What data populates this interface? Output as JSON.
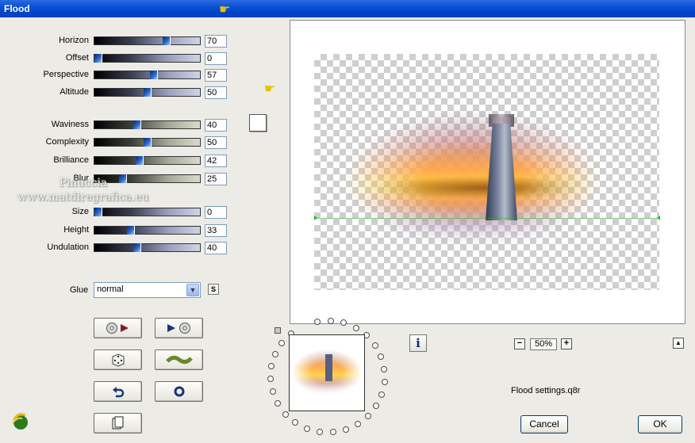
{
  "window": {
    "title": "Flood"
  },
  "sliders": [
    {
      "label": "Horizon",
      "value": "70",
      "level": 0.7,
      "style": "dark"
    },
    {
      "label": "Offset",
      "value": "0",
      "level": 0.0,
      "style": "dark"
    },
    {
      "label": "Perspective",
      "value": "57",
      "level": 0.57,
      "style": "dark"
    },
    {
      "label": "Altitude",
      "value": "50",
      "level": 0.5,
      "style": "dark"
    },
    {
      "label": "Waviness",
      "value": "40",
      "level": 0.4,
      "style": "olive"
    },
    {
      "label": "Complexity",
      "value": "50",
      "level": 0.5,
      "style": "olive"
    },
    {
      "label": "Brilliance",
      "value": "42",
      "level": 0.42,
      "style": "olive"
    },
    {
      "label": "Blur",
      "value": "25",
      "level": 0.25,
      "style": "olive"
    },
    {
      "label": "Size",
      "value": "0",
      "level": 0.0,
      "style": "dark"
    },
    {
      "label": "Height",
      "value": "33",
      "level": 0.33,
      "style": "dark"
    },
    {
      "label": "Undulation",
      "value": "40",
      "level": 0.4,
      "style": "dark"
    }
  ],
  "glue": {
    "label": "Glue",
    "value": "normal",
    "s_button": "S"
  },
  "watermark": {
    "line1": "Pinuccia",
    "line2": "www.matdiregrafica.eu"
  },
  "preview": {
    "zoom": "50%",
    "settings_file": "Flood settings.q8r"
  },
  "buttons": {
    "cancel": "Cancel",
    "ok": "OK",
    "info": "i"
  },
  "icons": {
    "hand": "pointing-hand-icon",
    "zoom_out": "minus-icon",
    "zoom_in": "plus-icon"
  },
  "colors": {
    "titlebar": "#0a4fd4",
    "accent": "#2a66c8",
    "horizon_marker": "#22bb22"
  }
}
